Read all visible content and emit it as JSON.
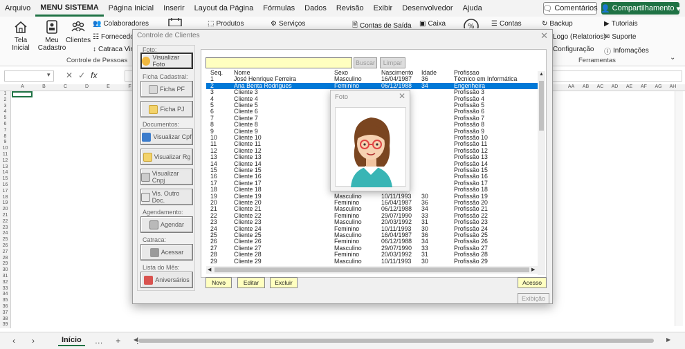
{
  "menu": {
    "tabs": [
      "Arquivo",
      "MENU SISTEMA",
      "Página Inicial",
      "Inserir",
      "Layout da Página",
      "Fórmulas",
      "Dados",
      "Revisão",
      "Exibir",
      "Desenvolvedor",
      "Ajuda"
    ],
    "comments_label": "Comentários",
    "share_label": "Compartilhamento"
  },
  "ribbon": {
    "tela_inicial": "Tela\nInicial",
    "meu_cadastro": "Meu\nCadastro",
    "clientes": "Clientes",
    "colaboradores": "Colaboradores",
    "fornecedores": "Fornecedo",
    "catraca": "Catraca Vir",
    "produtos": "Produtos",
    "servicos": "Serviços",
    "contas_saida": "Contas de Saída",
    "caixa": "Caixa",
    "contas": "Contas",
    "backup": "Backup",
    "logo": "Logo (Relatorios)",
    "configuracao": "Configuração",
    "tutoriais": "Tutoriais",
    "suporte": "Suporte",
    "informacoes": "Infomações",
    "group_pessoas": "Controle de Pessoas",
    "group_ferramentas": "Ferramentas"
  },
  "formula": {
    "namebox": ""
  },
  "sheet": {
    "columns_left": [
      "A",
      "B",
      "C",
      "D",
      "E",
      "F",
      "G",
      "H",
      "I"
    ],
    "columns_right": [
      "AA",
      "AB",
      "AC",
      "AD",
      "AE",
      "AF",
      "AG",
      "AH",
      "AI"
    ],
    "rows": [
      "1",
      "2",
      "3",
      "4",
      "5",
      "6",
      "7",
      "8",
      "9",
      "10",
      "11",
      "12",
      "13",
      "14",
      "15",
      "16",
      "17",
      "18",
      "19",
      "20",
      "21",
      "22",
      "23",
      "24",
      "25",
      "26",
      "27",
      "28",
      "29",
      "30",
      "31",
      "32",
      "33",
      "34",
      "35",
      "36",
      "37",
      "38",
      "39"
    ],
    "tab_name": "Início"
  },
  "dialog": {
    "title": "Controle de Clientes",
    "sections": {
      "foto": "Foto:",
      "ficha": "Ficha Cadastral:",
      "documentos": "Documentos:",
      "agendamento": "Agendamento:",
      "catraca": "Catraca:",
      "lista": "Lista do Mês:"
    },
    "buttons": {
      "visualizar_foto": "Visualizar Foto",
      "ficha_pf": "Ficha PF",
      "ficha_pj": "Ficha PJ",
      "visualizar_cpf": "Visualizar Cpf",
      "visualizar_rg": "Visualizar Rg",
      "visualizar_cnpj": "Visualizar Cnpj",
      "vis_outro": "Vis. Outro Doc.",
      "agendar": "Agendar",
      "acessar": "Acessar",
      "aniversarios": "Aniversários",
      "buscar": "Buscar",
      "limpar": "Limpar",
      "novo": "Novo",
      "editar": "Editar",
      "excluir": "Excluir",
      "acesso": "Acesso",
      "exibicao": "Exibição"
    },
    "search_value": "",
    "table": {
      "headers": [
        "Seq.",
        "Nome",
        "Sexo",
        "Nascimento",
        "Idade",
        "Profissao"
      ],
      "selected_index": 1,
      "rows": [
        [
          "1",
          "José Henrique Ferreira",
          "Masculino",
          "16/04/1987",
          "36",
          "Técnico em Informática"
        ],
        [
          "2",
          "Ana Benta Rodrigues",
          "Feminino",
          "06/12/1988",
          "34",
          "Engenheira"
        ],
        [
          "3",
          "Cliente 3",
          "",
          "",
          "",
          "Profissão 3"
        ],
        [
          "4",
          "Cliente 4",
          "",
          "",
          "",
          "Profissão 4"
        ],
        [
          "5",
          "Cliente 5",
          "",
          "",
          "",
          "Profissão 5"
        ],
        [
          "6",
          "Cliente 6",
          "",
          "",
          "",
          "Profissão 6"
        ],
        [
          "7",
          "Cliente 7",
          "",
          "",
          "",
          "Profissão 7"
        ],
        [
          "8",
          "Cliente 8",
          "",
          "",
          "",
          "Profissão 8"
        ],
        [
          "9",
          "Cliente 9",
          "",
          "",
          "",
          "Profissão 9"
        ],
        [
          "10",
          "Cliente 10",
          "",
          "",
          "",
          "Profissão 10"
        ],
        [
          "11",
          "Cliente 11",
          "",
          "",
          "",
          "Profissão 11"
        ],
        [
          "12",
          "Cliente 12",
          "",
          "",
          "",
          "Profissão 12"
        ],
        [
          "13",
          "Cliente 13",
          "",
          "",
          "",
          "Profissão 13"
        ],
        [
          "14",
          "Cliente 14",
          "",
          "",
          "",
          "Profissão 14"
        ],
        [
          "15",
          "Cliente 15",
          "",
          "",
          "",
          "Profissão 15"
        ],
        [
          "16",
          "Cliente 16",
          "",
          "",
          "",
          "Profissão 16"
        ],
        [
          "17",
          "Cliente 17",
          "",
          "",
          "",
          "Profissão 17"
        ],
        [
          "18",
          "Cliente 18",
          "",
          "",
          "",
          "Profissão 18"
        ],
        [
          "19",
          "Cliente 19",
          "Masculino",
          "10/11/1993",
          "30",
          "Profissão 19"
        ],
        [
          "20",
          "Cliente 20",
          "Feminino",
          "16/04/1987",
          "36",
          "Profissão 20"
        ],
        [
          "21",
          "Cliente 21",
          "Masculino",
          "06/12/1988",
          "34",
          "Profissão 21"
        ],
        [
          "22",
          "Cliente 22",
          "Feminino",
          "29/07/1990",
          "33",
          "Profissão 22"
        ],
        [
          "23",
          "Cliente 23",
          "Masculino",
          "20/03/1992",
          "31",
          "Profissão 23"
        ],
        [
          "24",
          "Cliente 24",
          "Feminino",
          "10/11/1993",
          "30",
          "Profissão 24"
        ],
        [
          "25",
          "Cliente 25",
          "Masculino",
          "16/04/1987",
          "36",
          "Profissão 25"
        ],
        [
          "26",
          "Cliente 26",
          "Feminino",
          "06/12/1988",
          "34",
          "Profissão 26"
        ],
        [
          "27",
          "Cliente 27",
          "Masculino",
          "29/07/1990",
          "33",
          "Profissão 27"
        ],
        [
          "28",
          "Cliente 28",
          "Feminino",
          "20/03/1992",
          "31",
          "Profissão 28"
        ],
        [
          "29",
          "Cliente 29",
          "Masculino",
          "10/11/1993",
          "30",
          "Profissão 29"
        ]
      ]
    }
  },
  "foto_popup": {
    "title": "Foto"
  },
  "colors": {
    "excel_green": "#1f7244",
    "selection_blue": "#0078d7",
    "input_yellow": "#ffffc0"
  }
}
